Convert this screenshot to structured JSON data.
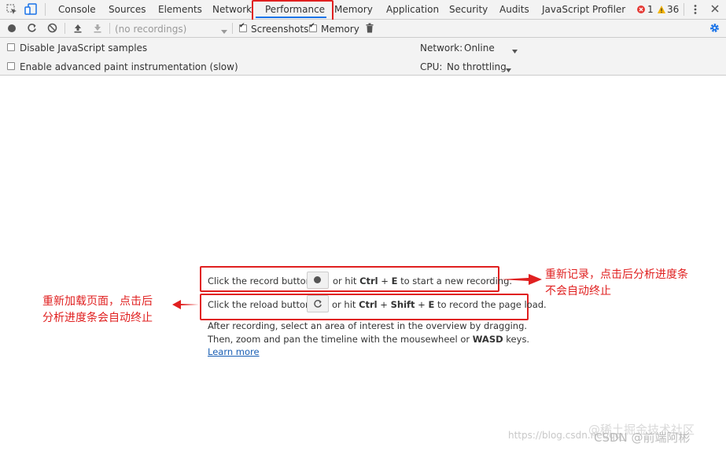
{
  "tabs": {
    "items": [
      "Console",
      "Sources",
      "Elements",
      "Network",
      "Performance",
      "Memory",
      "Application",
      "Security",
      "Audits",
      "JavaScript Profiler"
    ],
    "active": "Performance",
    "errors_count": "1",
    "warnings_count": "36"
  },
  "toolbar": {
    "recordings_select": "(no recordings)",
    "screenshots_label": "Screenshots",
    "memory_label": "Memory"
  },
  "settings": {
    "disable_js_samples": "Disable JavaScript samples",
    "enable_paint": "Enable advanced paint instrumentation (slow)",
    "network_label": "Network:",
    "network_value": "Online",
    "cpu_label": "CPU:",
    "cpu_value": "No throttling"
  },
  "landing": {
    "record_pre": "Click the record button",
    "record_post_1": "or hit ",
    "record_key1": "Ctrl",
    "record_plus": " + ",
    "record_key2": "E",
    "record_post_2": " to start a new recording.",
    "reload_pre": "Click the reload button",
    "reload_post_1": "or hit ",
    "reload_key1": "Ctrl",
    "reload_key2": "Shift",
    "reload_key3": "E",
    "reload_post_2": " to record the page load.",
    "after_line1": "After recording, select an area of interest in the overview by dragging.",
    "after_line2_a": "Then, zoom and pan the timeline with the mousewheel or ",
    "after_line2_key": "WASD",
    "after_line2_b": " keys.",
    "learn_more": "Learn more"
  },
  "annotations": {
    "right_line1": "重新记录，点击后分析进度条",
    "right_line2": "不会自动终止",
    "left_line1": "重新加载页面，点击后",
    "left_line2": "分析进度条会自动终止"
  },
  "watermark": {
    "url_text": "https://blog.csdn.net/qq_",
    "csdn_text": "CSDN @前端阿彬",
    "juejin_text": "@稀土掘金技术社区"
  },
  "colors": {
    "accent": "#1a73e8",
    "annotation_red": "#e02020",
    "error_red": "#e53935",
    "warning_yellow": "#f4b400"
  }
}
